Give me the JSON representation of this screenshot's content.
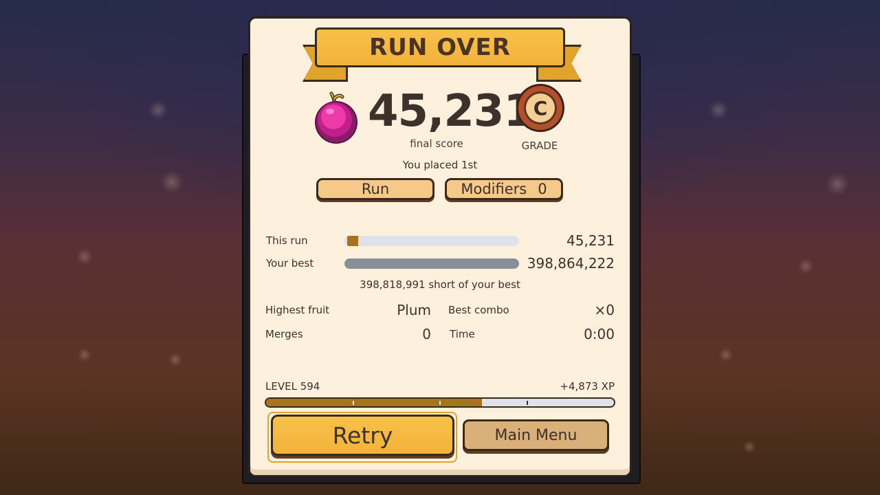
{
  "banner": {
    "title": "RUN OVER"
  },
  "score": {
    "value": "45,231",
    "label": "final score",
    "fruit_icon": "plum-icon"
  },
  "grade": {
    "letter": "C",
    "label": "GRADE"
  },
  "placement": "You placed 1st",
  "tabs": {
    "run_label": "Run",
    "modifiers_label": "Modifiers",
    "modifiers_count": "0"
  },
  "comparison": {
    "this_run_label": "This run",
    "this_run_value": "45,231",
    "your_best_label": "Your best",
    "your_best_value": "398,864,222",
    "short_text": "398,818,991 short of your best"
  },
  "stats": {
    "highest_fruit_label": "Highest fruit",
    "highest_fruit_value": "Plum",
    "best_combo_label": "Best combo",
    "best_combo_value": "×0",
    "merges_label": "Merges",
    "merges_value": "0",
    "time_label": "Time",
    "time_value": "0:00"
  },
  "level": {
    "label": "LEVEL 594",
    "xp_gain": "+4,873 XP",
    "progress": 0.62
  },
  "buttons": {
    "retry": "Retry",
    "main_menu": "Main Menu"
  },
  "colors": {
    "accent_gold": "#f2b33a",
    "card_bg": "#fdf0dc",
    "bar_fill": "#a8721f",
    "text_dark": "#3d312b"
  }
}
